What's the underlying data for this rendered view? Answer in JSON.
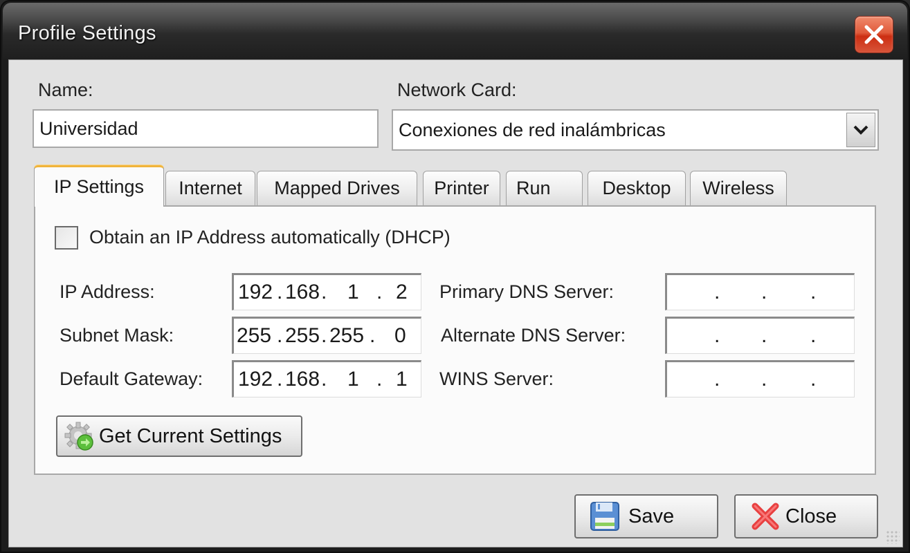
{
  "window": {
    "title": "Profile Settings",
    "close_icon": "close-icon"
  },
  "form": {
    "name_label": "Name:",
    "name_value": "Universidad",
    "network_card_label": "Network Card:",
    "network_card_value": "Conexiones de red inalámbricas"
  },
  "tabs": [
    {
      "label": "IP Settings",
      "active": true
    },
    {
      "label": "Internet",
      "active": false
    },
    {
      "label": "Mapped Drives",
      "active": false
    },
    {
      "label": "Printer",
      "active": false
    },
    {
      "label": "Run",
      "active": false
    },
    {
      "label": "Desktop",
      "active": false
    },
    {
      "label": "Wireless",
      "active": false
    }
  ],
  "ip_settings": {
    "dhcp_label": "Obtain an IP Address automatically (DHCP)",
    "dhcp_checked": false,
    "ip_address": {
      "label": "IP Address:",
      "octets": [
        "192",
        "168",
        "1",
        "2"
      ]
    },
    "subnet_mask": {
      "label": "Subnet Mask:",
      "octets": [
        "255",
        "255",
        "255",
        "0"
      ]
    },
    "default_gateway": {
      "label": "Default Gateway:",
      "octets": [
        "192",
        "168",
        "1",
        "1"
      ]
    },
    "primary_dns": {
      "label": "Primary DNS Server:",
      "octets": [
        "",
        "",
        "",
        ""
      ]
    },
    "alternate_dns": {
      "label": "Alternate DNS Server:",
      "octets": [
        "",
        "",
        "",
        ""
      ]
    },
    "wins_server": {
      "label": "WINS Server:",
      "octets": [
        "",
        "",
        "",
        ""
      ]
    },
    "get_current_label": "Get Current Settings"
  },
  "footer": {
    "save_label": "Save",
    "close_label": "Close"
  },
  "colors": {
    "active_tab_accent": "#f0b43c",
    "title_close_red": "#d8452a"
  }
}
